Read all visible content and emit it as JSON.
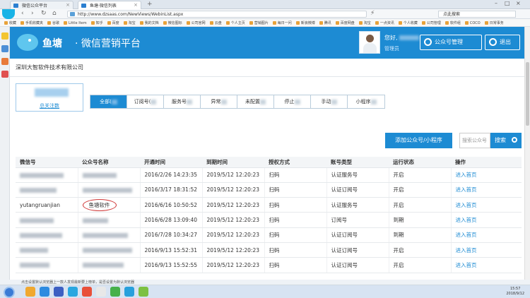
{
  "browser": {
    "tabs": [
      {
        "label": "微信公众平台",
        "active": false
      },
      {
        "label": "鱼塘·微信列表",
        "active": true
      }
    ],
    "new_tab": "+",
    "url": "http://www.dzsaas.com/NewViews/WebinList.aspx",
    "search_placeholder": "点此搜索",
    "bookmarks": [
      "收藏",
      "手机收藏夹",
      "谷歌",
      "Little Item",
      "知乎",
      "百度",
      "淘宝",
      "我的文档",
      "微信图标",
      "公司官网",
      "云盘",
      "个人主页",
      "营销图片",
      "每日一问",
      "新浪微博",
      "腾讯",
      "百度网盘",
      "淘宝",
      "一点资讯",
      "个人收藏",
      "公司管理",
      "软件组",
      "COCO",
      "日常事务"
    ]
  },
  "header": {
    "brand": "鱼塘",
    "subtitle": "· 微信营销平台",
    "greeting": "您好,",
    "role": "管理员",
    "manage_button": "公众号管理",
    "logout_button": "退出"
  },
  "company": "深圳大智软件技术有限公司",
  "stats": {
    "label": "总关注数"
  },
  "filter_tabs": [
    {
      "label": "全部(",
      "active": true
    },
    {
      "label": "订阅号(",
      "active": false
    },
    {
      "label": "服务号",
      "active": false
    },
    {
      "label": "异常",
      "active": false
    },
    {
      "label": "未配置",
      "active": false
    },
    {
      "label": "停止",
      "active": false
    },
    {
      "label": "手动",
      "active": false
    },
    {
      "label": "小程序",
      "active": false
    }
  ],
  "actions": {
    "add_label": "添加公众号/小程序",
    "search_placeholder": "搜索公众号",
    "search_button": "搜索"
  },
  "table": {
    "columns": [
      "微信号",
      "公众号名称",
      "开通时间",
      "到期时间",
      "授权方式",
      "账号类型",
      "运行状态",
      "操作"
    ],
    "rows": [
      {
        "wx": "",
        "name": "",
        "open": "2016/2/26 14:23:35",
        "expire": "2019/5/12 12:20:23",
        "auth": "扫码",
        "type": "认证服务号",
        "status": "开启",
        "op": "进入首页"
      },
      {
        "wx": "",
        "name": "",
        "open": "2016/3/17 18:31:52",
        "expire": "2019/5/12 12:20:23",
        "auth": "扫码",
        "type": "认证订阅号",
        "status": "开启",
        "op": "进入首页"
      },
      {
        "wx": "yutangruanjian",
        "name": "鱼塘软件",
        "open": "2016/6/16 10:50:52",
        "expire": "2019/5/12 12:20:23",
        "auth": "扫码",
        "type": "认证服务号",
        "status": "开启",
        "op": "进入首页"
      },
      {
        "wx": "",
        "name": "",
        "open": "2016/6/28 13:09:40",
        "expire": "2019/5/12 12:20:23",
        "auth": "扫码",
        "type": "订阅号",
        "status": "到期",
        "op": "进入首页"
      },
      {
        "wx": "",
        "name": "",
        "open": "2016/7/28 10:34:27",
        "expire": "2019/5/12 12:20:23",
        "auth": "扫码",
        "type": "认证订阅号",
        "status": "到期",
        "op": "进入首页"
      },
      {
        "wx": "",
        "name": "",
        "open": "2016/9/13 15:52:31",
        "expire": "2019/5/12 12:20:23",
        "auth": "扫码",
        "type": "认证订阅号",
        "status": "开启",
        "op": "进入首页"
      },
      {
        "wx": "",
        "name": "",
        "open": "2016/9/13 15:52:55",
        "expire": "2019/5/12 12:20:23",
        "auth": "扫码",
        "type": "认证订阅号",
        "status": "开启",
        "op": "进入首页"
      }
    ]
  },
  "statusbar": {
    "text": "点击设置默认浏览器上一款人发现最新要上榜单，是否设置为默认浏览器"
  },
  "clock": {
    "time": "15:57",
    "date": "2018/9/12"
  },
  "colors": {
    "primary": "#1d8bd3",
    "highlight": "#d03a3a"
  }
}
